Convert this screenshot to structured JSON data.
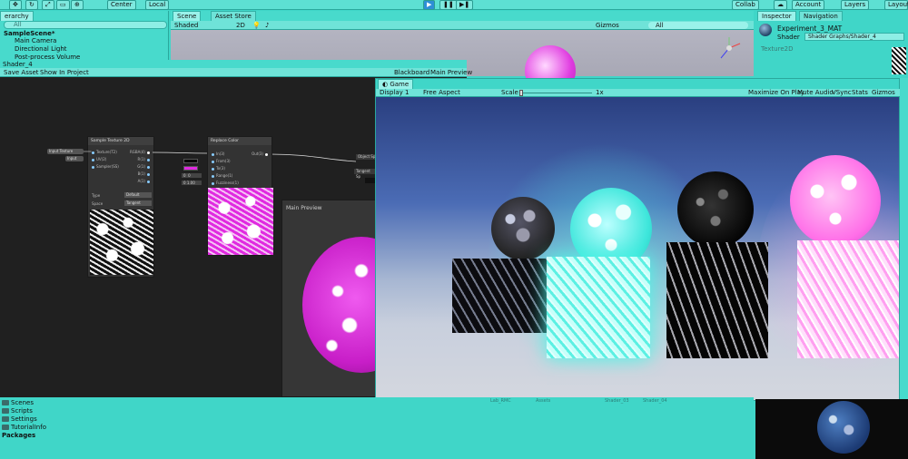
{
  "toolbar": {
    "pivot": "Center",
    "space": "Local",
    "collab": "Collab",
    "account": "Account",
    "layers": "Layers",
    "layout": "Layout"
  },
  "hierarchy": {
    "tab": "erarchy",
    "search_placeholder": "All",
    "scene": "SampleScene*",
    "items": [
      "Main Camera",
      "Directional Light",
      "Post-process Volume"
    ]
  },
  "scene_view": {
    "tab_scene": "Scene",
    "tab_asset_store": "Asset Store",
    "shading": "Shaded",
    "mode_2d": "2D",
    "gizmos": "Gizmos",
    "search_placeholder": "All"
  },
  "inspector": {
    "tab_inspector": "Inspector",
    "tab_navigation": "Navigation",
    "material_name": "Experiment_3_MAT",
    "shader_label": "Shader",
    "shader_value": "Shader Graphs/Shader_4",
    "texture_label": "Texture2D"
  },
  "shader_graph": {
    "title": "Shader_4",
    "save_asset": "Save Asset",
    "show_in_project": "Show In Project",
    "blackboard": "Blackboard",
    "main_preview_btn": "Main Preview",
    "main_preview_title": "Main Preview",
    "input_chip": "Input Texture",
    "input_chip2": "Input",
    "sample_node": {
      "title": "Sample Texture 2D",
      "inputs": [
        "Texture(T2)",
        "UV(2)",
        "Sampler(SS)"
      ],
      "outputs": [
        "RGBA(4)",
        "R(1)",
        "G(1)",
        "B(1)",
        "A(1)"
      ],
      "type_label": "Type",
      "type_value": "Default",
      "space_label": "Space",
      "space_value": "Tangent"
    },
    "replace_node": {
      "title": "Replace Color",
      "inputs": [
        "In(3)",
        "From(3)",
        "To(3)",
        "Range(1)",
        "Fuzziness(1)"
      ],
      "output": "Out(3)",
      "range_values": [
        "0",
        "0"
      ],
      "fuzz_values": [
        "0",
        "1.00"
      ]
    },
    "master_ports": [
      "Object Sp",
      "Tangent Sp"
    ]
  },
  "game_view": {
    "tab": "Game",
    "display": "Display 1",
    "aspect": "Free Aspect",
    "scale_label": "Scale",
    "scale_value": "1x",
    "maximize": "Maximize On Play",
    "mute": "Mute Audio",
    "vsync": "VSync",
    "stats": "Stats",
    "gizmos": "Gizmos"
  },
  "project": {
    "folders": [
      "Scenes",
      "Scripts",
      "Settings",
      "TutorialInfo"
    ],
    "packages": "Packages",
    "asset_labels": [
      "Lab_RMC",
      "Assets",
      "Shader_03",
      "Shader_04"
    ]
  },
  "colors": {
    "accent": "#40d6c8",
    "magenta": "#e02ae0",
    "cyan_glow": "#4ff5e6"
  }
}
